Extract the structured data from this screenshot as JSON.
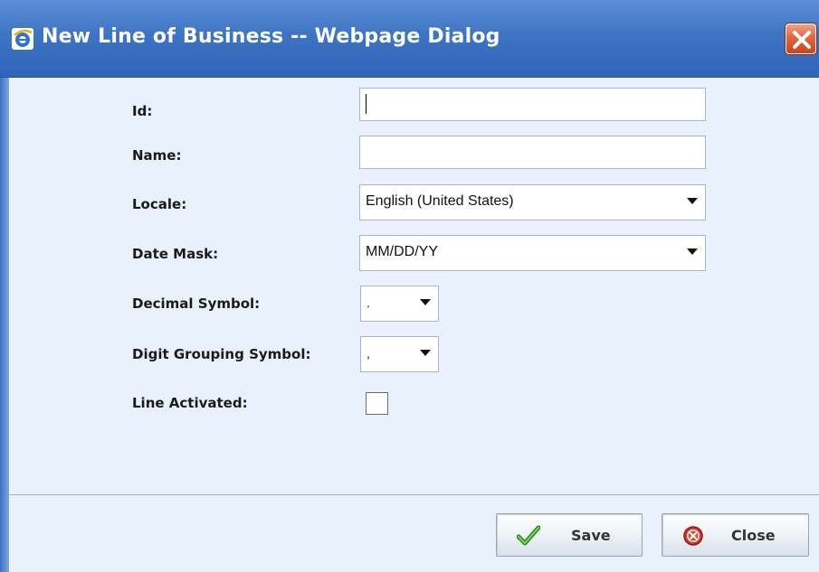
{
  "window": {
    "title": "New Line of Business -- Webpage Dialog",
    "icon": "ie-icon",
    "close_icon": "close-x-icon"
  },
  "form": {
    "id": {
      "label": "Id:",
      "value": ""
    },
    "name": {
      "label": "Name:",
      "value": ""
    },
    "locale": {
      "label": "Locale:",
      "value": "English (United States)"
    },
    "date_mask": {
      "label": "Date Mask:",
      "value": "MM/DD/YY"
    },
    "decimal_symbol": {
      "label": "Decimal Symbol:",
      "value": "."
    },
    "digit_grouping_symbol": {
      "label": "Digit Grouping Symbol:",
      "value": ","
    },
    "line_activated": {
      "label": "Line Activated:",
      "checked": false
    }
  },
  "buttons": {
    "save": {
      "label": "Save",
      "icon": "checkmark-icon"
    },
    "close": {
      "label": "Close",
      "icon": "close-circle-icon"
    }
  },
  "colors": {
    "titlebar": "#3e74c4",
    "background": "#e8f1fc",
    "close_button": "#e0663e"
  }
}
